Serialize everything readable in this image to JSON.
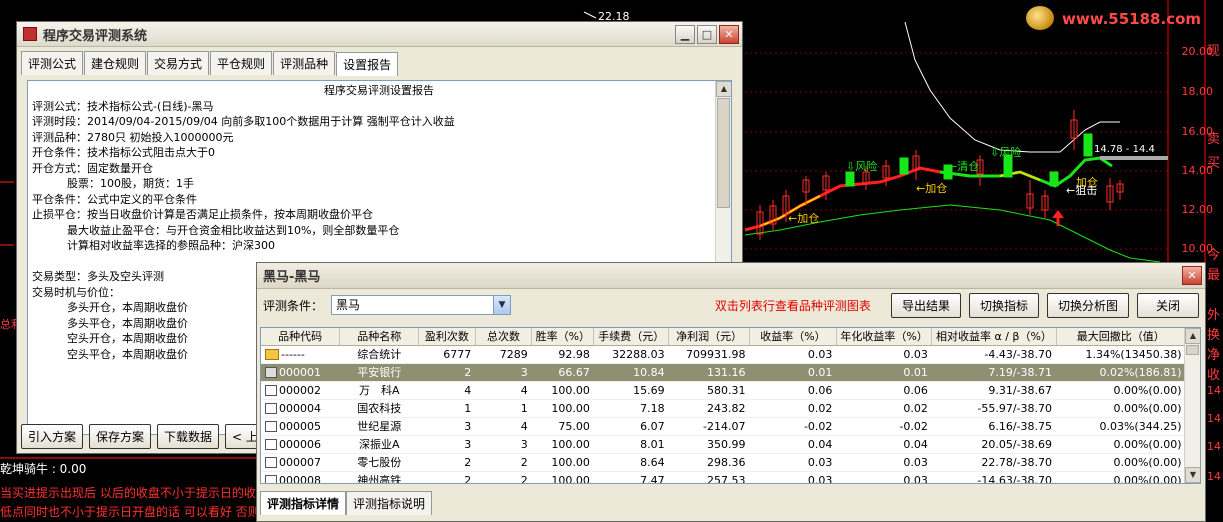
{
  "background": {
    "top_label": "22.18",
    "prices": [
      "20.00",
      "18.00",
      "16.00",
      "14.00",
      "12.00",
      "10.00"
    ],
    "right_cjk": [
      "现",
      "卖",
      "买",
      "今",
      "最",
      "外",
      "换",
      "净",
      "收",
      "14",
      "14",
      "14",
      "14"
    ],
    "logo": "www.55188.com",
    "annotations": [
      "风险",
      "风险",
      "←清仓",
      "←加仓",
      "←加仓",
      "加仓",
      "←狙击",
      "14.78 - 14.4"
    ],
    "left_stubs": {
      "row1": "总利",
      "row2": "乾坤骑牛 : 0.00"
    },
    "bottom_lines": [
      "当买进提示出现后 以后的收盘不小于提示日的收盘",
      "低点同时也不小于提示日开盘的话 可以看好 否则"
    ],
    "colors": {
      "candle_up": "#ff2b2b",
      "candle_down": "#19e619",
      "ma_red": "#ff2020",
      "ma_yellow": "#ffd000",
      "ma_green": "#19e619",
      "axis": "#ff0000"
    }
  },
  "main_dialog": {
    "title": "程序交易评测系统",
    "tabs": [
      "评测公式",
      "建仓规则",
      "交易方式",
      "平仓规则",
      "评测品种",
      "设置报告"
    ],
    "active_tab": 5,
    "report_title": "程序交易评测设置报告",
    "report_lines": [
      "评测公式：技术指标公式-(日线)-黑马",
      "评测时段：2014/09/04-2015/09/04 向前多取100个数据用于计算 强制平仓计入收益",
      "评测品种：2780只 初始投入1000000元",
      "开仓条件：技术指标公式阻击点大于0",
      "开仓方式：固定数量开仓",
      "          股票：100股，期货：1手",
      "平仓条件：公式中定义的平仓条件",
      "止损平仓：按当日收盘价计算是否满足止损条件，按本周期收盘价平仓",
      "          最大收益止盈平仓：与开仓资金相比收益达到10%，则全部数量平仓",
      "          计算相对收益率选择的参照品种：沪深300",
      "",
      "交易类型：多头及空头评测",
      "交易时机与价位：",
      "          多头开仓，本周期收盘价",
      "          多头平仓，本周期收盘价",
      "          空头开仓，本周期收盘价",
      "          空头平仓，本周期收盘价"
    ],
    "buttons": [
      "引入方案",
      "保存方案",
      "下载数据",
      "< 上一步"
    ]
  },
  "result_dialog": {
    "title": "黑马-黑马",
    "condition_label": "评测条件：",
    "condition_value": "黑马",
    "hint": "双击列表行查看品种评测图表",
    "buttons": [
      "导出结果",
      "切换指标",
      "切换分析图",
      "关闭"
    ],
    "columns": [
      "品种代码",
      "品种名称",
      "盈利次数",
      "总次数",
      "胜率（%）",
      "手续费（元）",
      "净利润（元）",
      "收益率（%）",
      "年化收益率（%）",
      "相对收益率 α / β（%）",
      "最大回撤比（值）"
    ],
    "rows": [
      [
        "------",
        "综合统计",
        "6777",
        "7289",
        "92.98",
        "32288.03",
        "709931.98",
        "0.03",
        "0.03",
        "-4.43/-38.70",
        "1.34%(13450.38)"
      ],
      [
        "000001",
        "平安银行",
        "2",
        "3",
        "66.67",
        "10.84",
        "131.16",
        "0.01",
        "0.01",
        "7.19/-38.71",
        "0.02%(186.81)"
      ],
      [
        "000002",
        "万　科A",
        "4",
        "4",
        "100.00",
        "15.69",
        "580.31",
        "0.06",
        "0.06",
        "9.31/-38.67",
        "0.00%(0.00)"
      ],
      [
        "000004",
        "国农科技",
        "1",
        "1",
        "100.00",
        "7.18",
        "243.82",
        "0.02",
        "0.02",
        "-55.97/-38.70",
        "0.00%(0.00)"
      ],
      [
        "000005",
        "世纪星源",
        "3",
        "4",
        "75.00",
        "6.07",
        "-214.07",
        "-0.02",
        "-0.02",
        "6.16/-38.75",
        "0.03%(344.25)"
      ],
      [
        "000006",
        "深振业A",
        "3",
        "3",
        "100.00",
        "8.01",
        "350.99",
        "0.04",
        "0.04",
        "20.05/-38.69",
        "0.00%(0.00)"
      ],
      [
        "000007",
        "零七股份",
        "2",
        "2",
        "100.00",
        "8.64",
        "298.36",
        "0.03",
        "0.03",
        "22.78/-38.70",
        "0.00%(0.00)"
      ],
      [
        "000008",
        "神州高铁",
        "2",
        "2",
        "100.00",
        "7.47",
        "257.53",
        "0.03",
        "0.03",
        "-14.63/-38.70",
        "0.00%(0.00)"
      ]
    ],
    "selected_row": 1,
    "bottom_tabs": [
      "评测指标详情",
      "评测指标说明"
    ],
    "active_bottom_tab": 0
  }
}
